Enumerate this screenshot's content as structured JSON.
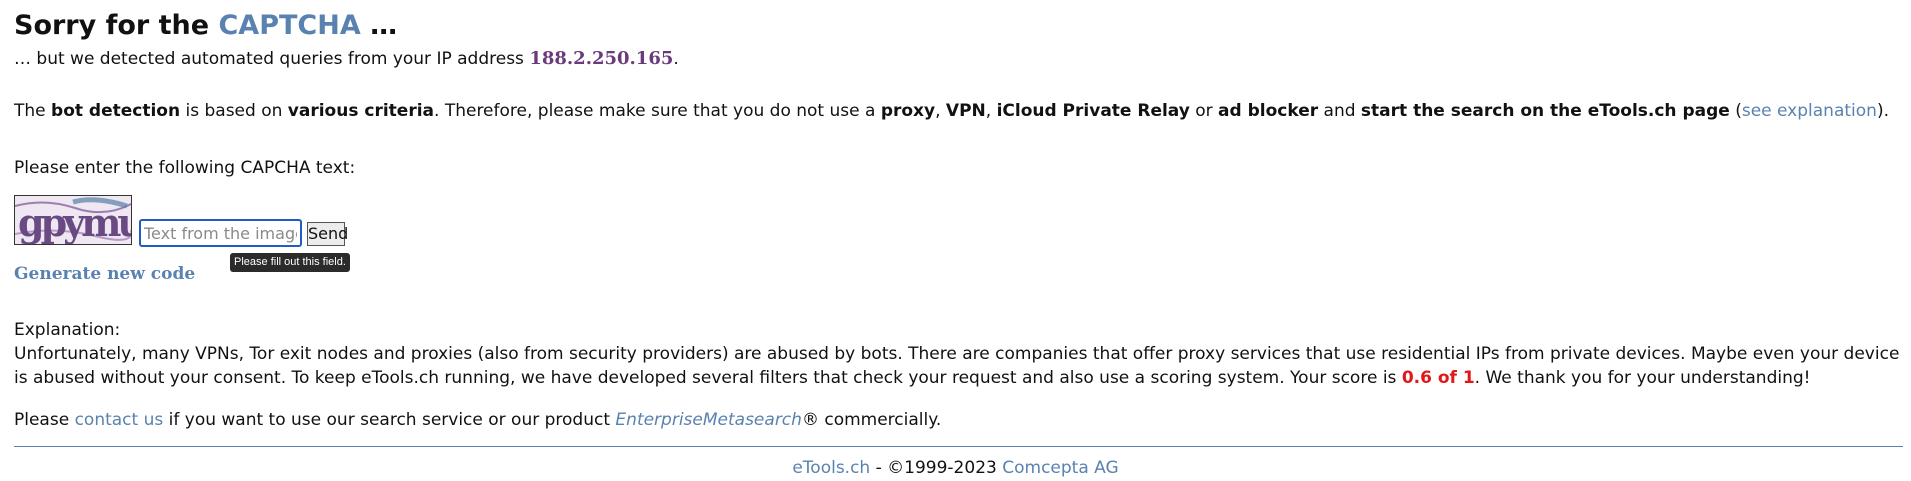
{
  "title": {
    "prefix": "Sorry for the",
    "accent": "CAPTCHA",
    "suffix": "…"
  },
  "detection": {
    "text": "… but we detected automated queries from your IP address",
    "ip": "188.2.250.165",
    "end": "."
  },
  "criteria": {
    "t1": "The",
    "b1": "bot detection",
    "t2": "is based on",
    "b2": "various criteria",
    "t3": ". Therefore, please make sure that you do not use a",
    "b3": "proxy",
    "t4": ",",
    "b4": "VPN",
    "t5": ",",
    "b5": "iCloud Private Relay",
    "t6": "or",
    "b6": "ad blocker",
    "t7": "and",
    "b7": "start the search on the eTools.ch page",
    "t8": "(",
    "link": "see explanation",
    "t9": ")."
  },
  "captcha": {
    "prompt": "Please enter the following CAPCHA text:",
    "image_text": "gpymu",
    "input_placeholder": "Text from the image",
    "input_value": "",
    "send_label": "Send",
    "tooltip": "Please fill out this field.",
    "generate_label": "Generate new code"
  },
  "explanation": {
    "heading": "Explanation:",
    "body": "Unfortunately, many VPNs, Tor exit nodes and proxies (also from security providers) are abused by bots. There are companies that offer proxy services that use residential IPs from private devices. Maybe even your device is abused without your consent. To keep eTools.ch running, we have developed several filters that check your request and also use a scoring system. Your score is",
    "score": "0.6 of 1",
    "after": ". We thank you for your understanding!"
  },
  "contact": {
    "t1": "Please",
    "link": "contact us",
    "t2": "if you want to use our search service or our product",
    "product": "EnterpriseMetasearch",
    "t3": "® commercially."
  },
  "footer": {
    "site": "eTools.ch",
    "copy": "- ©1999-2023",
    "company": "Comcepta AG"
  },
  "colors": {
    "accent": "#5a82b0",
    "ip": "#6b3a7d",
    "score": "#e01818",
    "input_focus": "#1e5cc8"
  }
}
